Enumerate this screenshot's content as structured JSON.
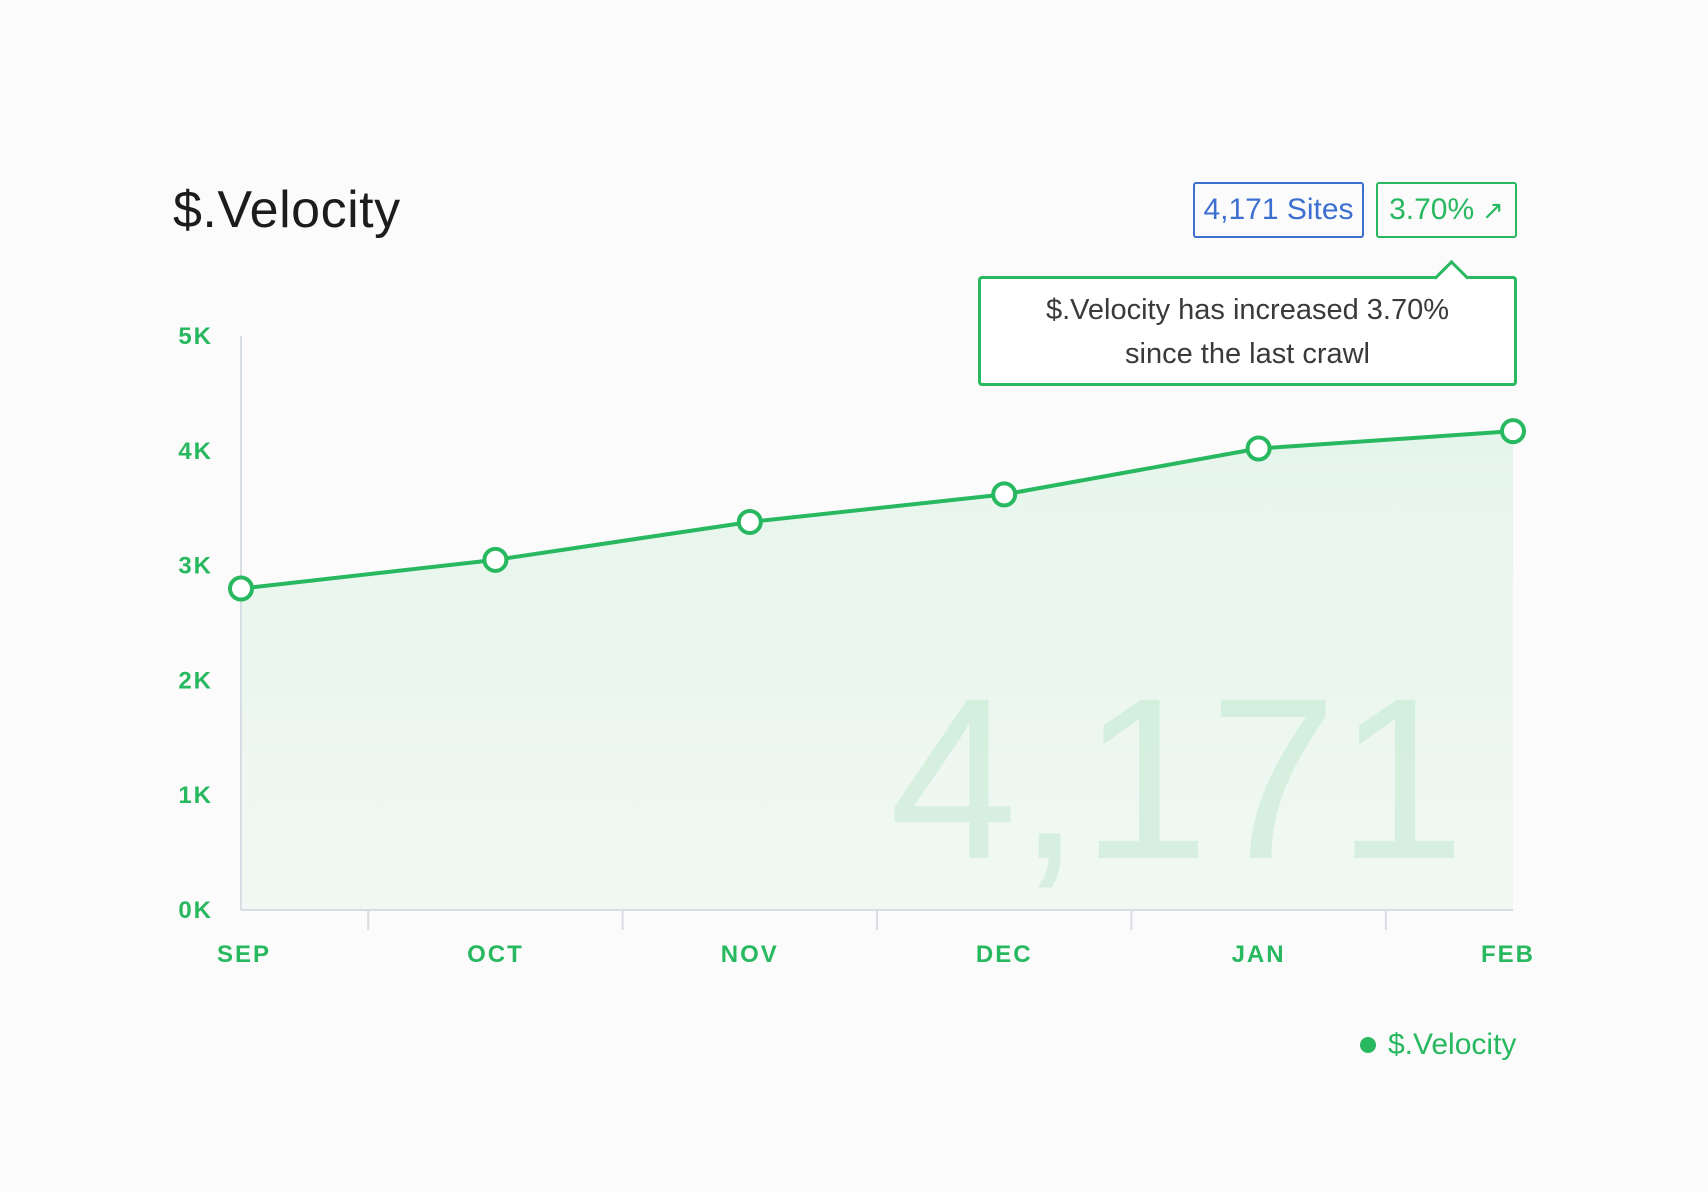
{
  "title": "$.Velocity",
  "badges": {
    "sites": "4,171 Sites",
    "change": "3.70%",
    "change_icon": "arrow-up-right-icon",
    "change_arrow": "↗"
  },
  "tooltip": {
    "line1": "$.Velocity has increased 3.70%",
    "line2": "since the last crawl"
  },
  "watermark": "4,171",
  "legend": {
    "label": "$.Velocity"
  },
  "colors": {
    "accent": "#27b860",
    "blue": "#3d6fd1",
    "fill": "#e9f6ee"
  },
  "chart_data": {
    "type": "area",
    "categories": [
      "SEP",
      "OCT",
      "NOV",
      "DEC",
      "JAN",
      "FEB"
    ],
    "series": [
      {
        "name": "$.Velocity",
        "values": [
          2800,
          3050,
          3380,
          3620,
          4020,
          4171
        ]
      }
    ],
    "ylim": [
      0,
      5000
    ],
    "yticks": [
      "0K",
      "1K",
      "2K",
      "3K",
      "4K",
      "5K"
    ],
    "xlabel": "",
    "ylabel": "",
    "grid": false,
    "legend_position": "bottom-right"
  }
}
